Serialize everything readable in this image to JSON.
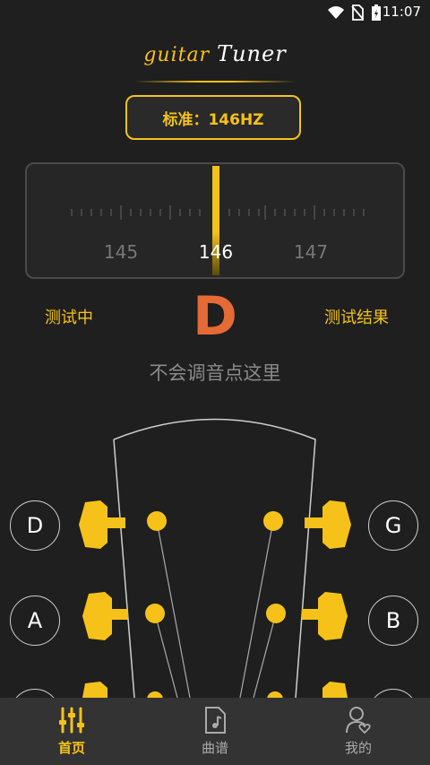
{
  "status": {
    "time": "11:07"
  },
  "logo": {
    "word1": "guitar",
    "word2": "Tuner"
  },
  "standard": {
    "label": "标准：146HZ"
  },
  "meter": {
    "left": "145",
    "center": "146",
    "right": "147"
  },
  "note": {
    "left_text": "测试中",
    "right_text": "测试结果",
    "current": "D",
    "hint": "不会调音点这里"
  },
  "strings": {
    "l1": "D",
    "l2": "A",
    "r1": "G",
    "r2": "B"
  },
  "tabs": [
    {
      "label": "首页"
    },
    {
      "label": "曲谱"
    },
    {
      "label": "我的"
    }
  ],
  "colors": {
    "accent": "#f6c21a",
    "note": "#e56a35"
  }
}
